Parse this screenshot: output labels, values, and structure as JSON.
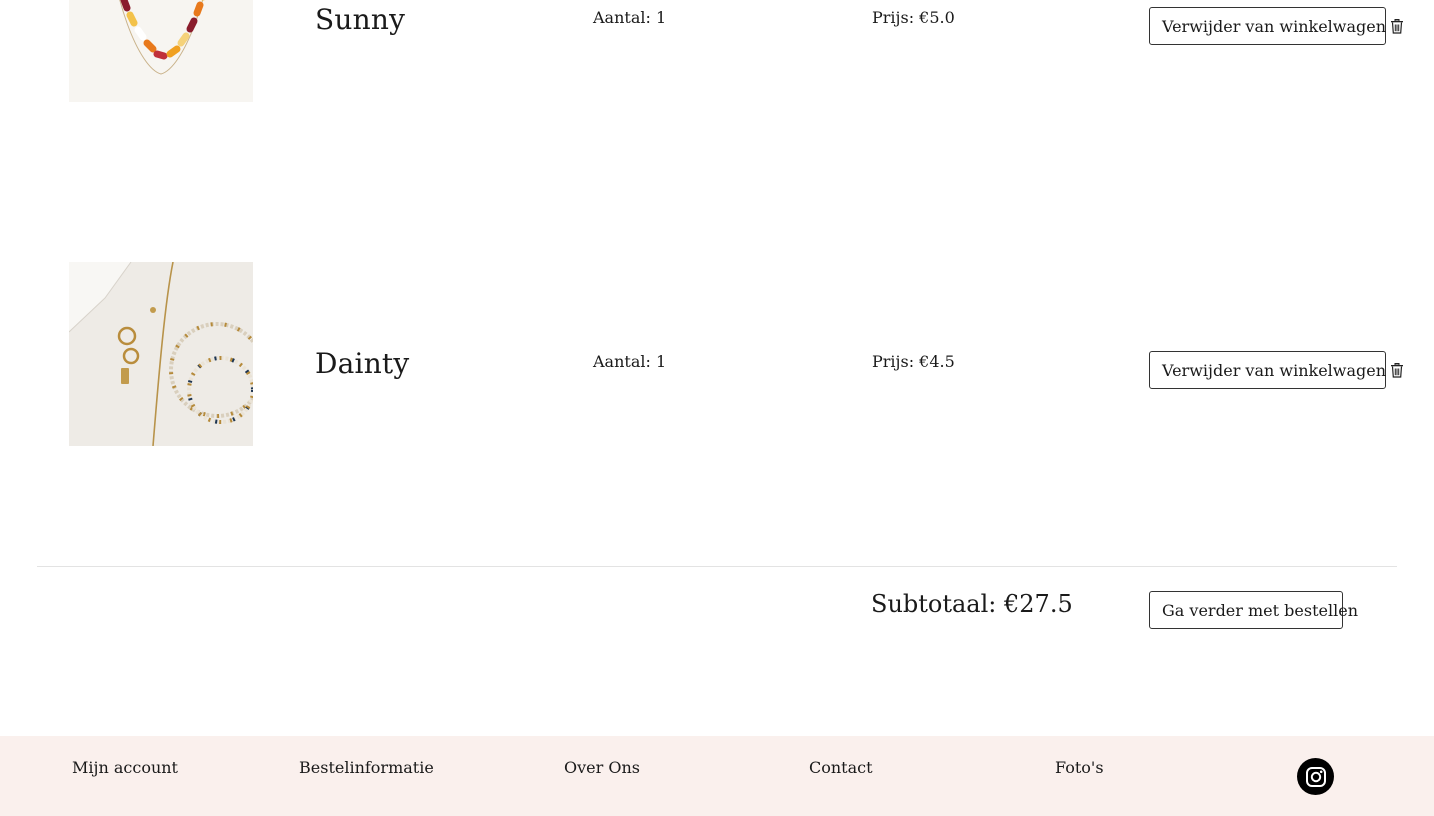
{
  "cart": {
    "items": [
      {
        "name": "Sunny",
        "quantity_text": "Aantal: 1",
        "price_text": "Prijs: €5.0",
        "remove_label": "Verwijder van winkelwagen"
      },
      {
        "name": "Dainty",
        "quantity_text": "Aantal: 1",
        "price_text": "Prijs: €4.5",
        "remove_label": "Verwijder van winkelwagen"
      }
    ],
    "subtotal_text": "Subtotaal: €27.5",
    "checkout_label": "Ga verder met bestellen",
    "remove_icon": "trash-icon"
  },
  "footer": {
    "links": [
      "Mijn account",
      "Bestelinformatie",
      "Over Ons",
      "Contact",
      "Foto's"
    ],
    "social_icon": "instagram-icon",
    "background": "#faf0ed"
  }
}
